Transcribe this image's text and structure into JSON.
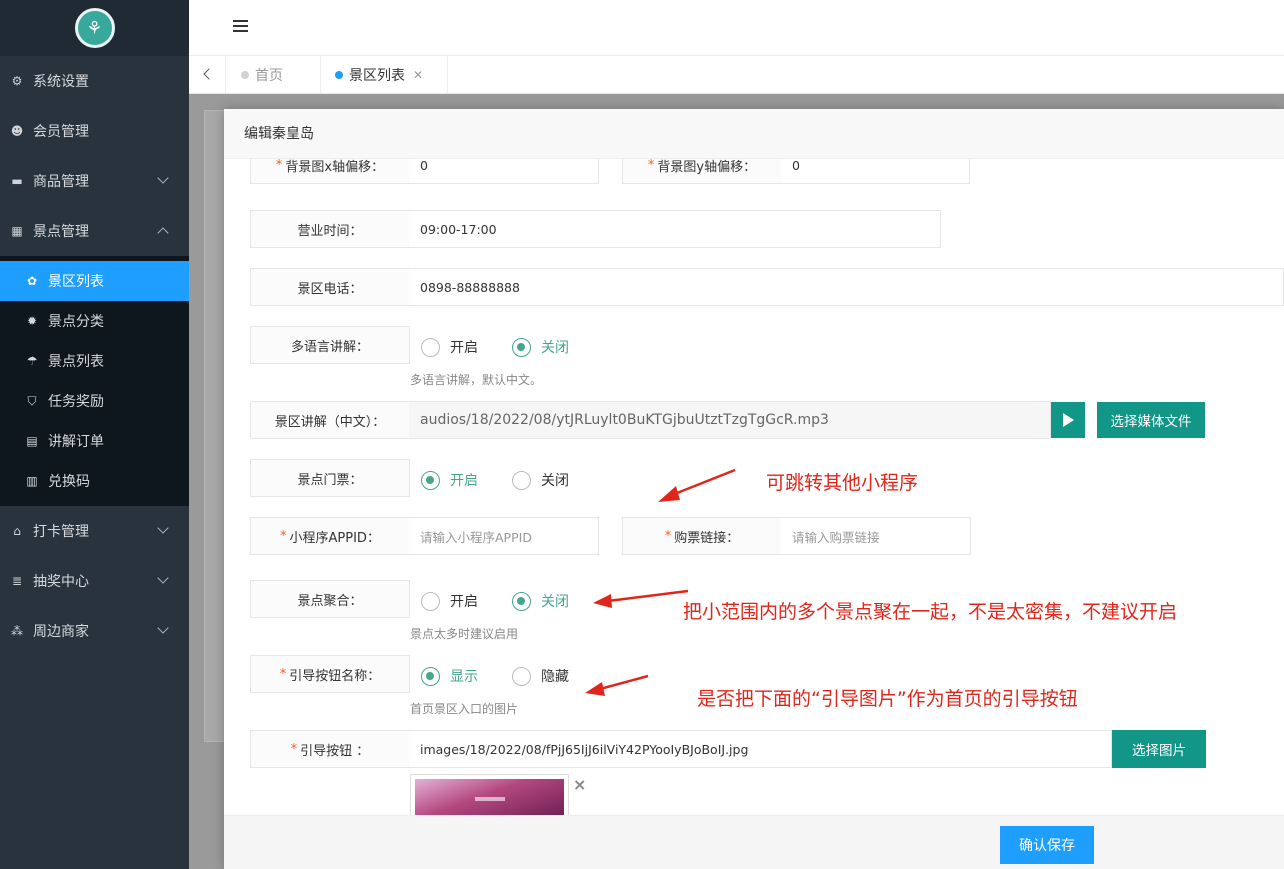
{
  "sidebar": {
    "menu": [
      {
        "label": "系统设置",
        "icon": "gears-icon"
      },
      {
        "label": "会员管理",
        "icon": "users-icon"
      },
      {
        "label": "商品管理",
        "icon": "cart-icon"
      },
      {
        "label": "景点管理",
        "icon": "grid-icon"
      },
      {
        "label": "打卡管理",
        "icon": "bank-icon"
      },
      {
        "label": "抽奖中心",
        "icon": "database-icon"
      },
      {
        "label": "周边商家",
        "icon": "sitemap-icon"
      }
    ],
    "submenu": [
      {
        "label": "景区列表",
        "icon": "cubes-icon"
      },
      {
        "label": "景点分类",
        "icon": "asterisk-icon"
      },
      {
        "label": "景点列表",
        "icon": "umbrella-icon"
      },
      {
        "label": "任务奖励",
        "icon": "shield-icon"
      },
      {
        "label": "讲解订单",
        "icon": "file-icon"
      },
      {
        "label": "兑换码",
        "icon": "barcode-icon"
      }
    ]
  },
  "tabs": [
    {
      "label": "首页",
      "active": false
    },
    {
      "label": "景区列表",
      "active": true
    }
  ],
  "colors": {
    "primary": "#1e9fff",
    "teal": "#119688",
    "radio_on": "#45a68b",
    "annotation": "#e0261b"
  },
  "modal": {
    "title": "编辑秦皇岛",
    "save_label": "确认保存",
    "bg_x": {
      "label": "背景图x轴偏移：",
      "value": "0"
    },
    "bg_y": {
      "label": "背景图y轴偏移：",
      "value": "0"
    },
    "hours": {
      "label": "营业时间：",
      "value": "09:00-17:00"
    },
    "phone": {
      "label": "景区电话：",
      "value": "0898-88888888"
    },
    "multilang": {
      "label": "多语言讲解：",
      "on": "开启",
      "off": "关闭",
      "hint": "多语言讲解，默认中文。"
    },
    "audio": {
      "label": "景区讲解（中文）：",
      "value": "audios/18/2022/08/ytJRLuylt0BuKTGjbuUtztTzgTgGcR.mp3",
      "select_label": "选择媒体文件"
    },
    "ticket": {
      "label": "景点门票：",
      "on": "开启",
      "off": "关闭"
    },
    "appid": {
      "label": "小程序APPID：",
      "placeholder": "请输入小程序APPID"
    },
    "buy_link": {
      "label": "购票链接：",
      "placeholder": "请输入购票链接"
    },
    "cluster": {
      "label": "景点聚合：",
      "on": "开启",
      "off": "关闭",
      "hint": "景点太多时建议启用"
    },
    "guide_name": {
      "label": "引导按钮名称：",
      "on": "显示",
      "off": "隐藏",
      "hint": "首页景区入口的图片"
    },
    "guide_btn": {
      "label": "引导按钮 ：",
      "value": "images/18/2022/08/fPjJ65IjJ6ilViY42PYooIyBJoBoIJ.jpg",
      "select_label": "选择图片"
    }
  },
  "annotations": {
    "a1": "可跳转其他小程序",
    "a2": "把小范围内的多个景点聚在一起，不是太密集，不建议开启",
    "a3": "是否把下面的“引导图片”作为首页的引导按钮"
  }
}
